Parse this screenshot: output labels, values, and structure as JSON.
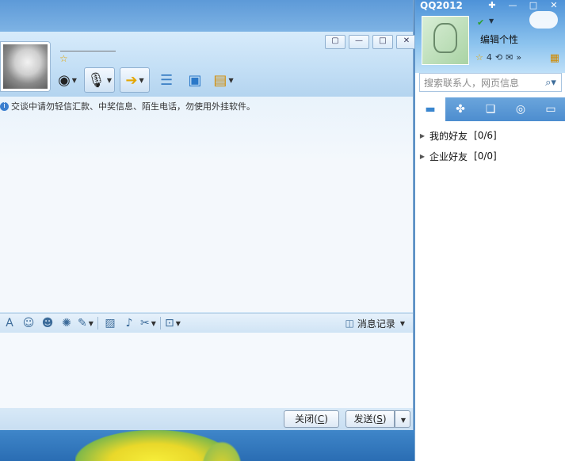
{
  "chat": {
    "window_buttons": [
      "▢",
      "—",
      "□",
      "✕"
    ],
    "notice": "交谈中请勿轻信汇款、中奖信息、陌生电话，勿使用外挂软件。",
    "history_label": "消息记录",
    "close_button": "关闭(",
    "close_key": "C",
    "close_end": ")",
    "send_button": "发送(",
    "send_key": "S",
    "send_end": ")"
  },
  "qq": {
    "title": "QQ2012",
    "signature": "编辑个性",
    "level": "4",
    "search_placeholder": "搜索联系人，网页信息",
    "groups": [
      {
        "name": "我的好友",
        "count": "[0/6]"
      },
      {
        "name": "企业好友",
        "count": "[0/0]"
      }
    ]
  },
  "icons": {
    "info": "info-icon",
    "webcam": "webcam-icon",
    "microphone": "microphone-icon",
    "file_transfer": "folder-arrow-icon",
    "chat_list": "chat-list-icon",
    "remote_desktop": "monitor-icon",
    "app": "notebook-icon"
  }
}
